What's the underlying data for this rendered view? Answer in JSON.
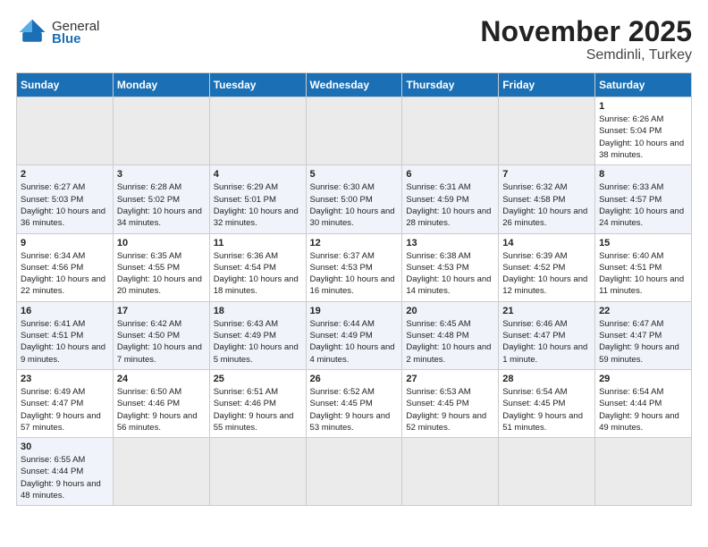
{
  "header": {
    "logo_general": "General",
    "logo_blue": "Blue",
    "title": "November 2025",
    "subtitle": "Semdinli, Turkey"
  },
  "days_of_week": [
    "Sunday",
    "Monday",
    "Tuesday",
    "Wednesday",
    "Thursday",
    "Friday",
    "Saturday"
  ],
  "weeks": [
    [
      {
        "day": "",
        "info": ""
      },
      {
        "day": "",
        "info": ""
      },
      {
        "day": "",
        "info": ""
      },
      {
        "day": "",
        "info": ""
      },
      {
        "day": "",
        "info": ""
      },
      {
        "day": "",
        "info": ""
      },
      {
        "day": "1",
        "info": "Sunrise: 6:26 AM\nSunset: 5:04 PM\nDaylight: 10 hours and 38 minutes."
      }
    ],
    [
      {
        "day": "2",
        "info": "Sunrise: 6:27 AM\nSunset: 5:03 PM\nDaylight: 10 hours and 36 minutes."
      },
      {
        "day": "3",
        "info": "Sunrise: 6:28 AM\nSunset: 5:02 PM\nDaylight: 10 hours and 34 minutes."
      },
      {
        "day": "4",
        "info": "Sunrise: 6:29 AM\nSunset: 5:01 PM\nDaylight: 10 hours and 32 minutes."
      },
      {
        "day": "5",
        "info": "Sunrise: 6:30 AM\nSunset: 5:00 PM\nDaylight: 10 hours and 30 minutes."
      },
      {
        "day": "6",
        "info": "Sunrise: 6:31 AM\nSunset: 4:59 PM\nDaylight: 10 hours and 28 minutes."
      },
      {
        "day": "7",
        "info": "Sunrise: 6:32 AM\nSunset: 4:58 PM\nDaylight: 10 hours and 26 minutes."
      },
      {
        "day": "8",
        "info": "Sunrise: 6:33 AM\nSunset: 4:57 PM\nDaylight: 10 hours and 24 minutes."
      }
    ],
    [
      {
        "day": "9",
        "info": "Sunrise: 6:34 AM\nSunset: 4:56 PM\nDaylight: 10 hours and 22 minutes."
      },
      {
        "day": "10",
        "info": "Sunrise: 6:35 AM\nSunset: 4:55 PM\nDaylight: 10 hours and 20 minutes."
      },
      {
        "day": "11",
        "info": "Sunrise: 6:36 AM\nSunset: 4:54 PM\nDaylight: 10 hours and 18 minutes."
      },
      {
        "day": "12",
        "info": "Sunrise: 6:37 AM\nSunset: 4:53 PM\nDaylight: 10 hours and 16 minutes."
      },
      {
        "day": "13",
        "info": "Sunrise: 6:38 AM\nSunset: 4:53 PM\nDaylight: 10 hours and 14 minutes."
      },
      {
        "day": "14",
        "info": "Sunrise: 6:39 AM\nSunset: 4:52 PM\nDaylight: 10 hours and 12 minutes."
      },
      {
        "day": "15",
        "info": "Sunrise: 6:40 AM\nSunset: 4:51 PM\nDaylight: 10 hours and 11 minutes."
      }
    ],
    [
      {
        "day": "16",
        "info": "Sunrise: 6:41 AM\nSunset: 4:51 PM\nDaylight: 10 hours and 9 minutes."
      },
      {
        "day": "17",
        "info": "Sunrise: 6:42 AM\nSunset: 4:50 PM\nDaylight: 10 hours and 7 minutes."
      },
      {
        "day": "18",
        "info": "Sunrise: 6:43 AM\nSunset: 4:49 PM\nDaylight: 10 hours and 5 minutes."
      },
      {
        "day": "19",
        "info": "Sunrise: 6:44 AM\nSunset: 4:49 PM\nDaylight: 10 hours and 4 minutes."
      },
      {
        "day": "20",
        "info": "Sunrise: 6:45 AM\nSunset: 4:48 PM\nDaylight: 10 hours and 2 minutes."
      },
      {
        "day": "21",
        "info": "Sunrise: 6:46 AM\nSunset: 4:47 PM\nDaylight: 10 hours and 1 minute."
      },
      {
        "day": "22",
        "info": "Sunrise: 6:47 AM\nSunset: 4:47 PM\nDaylight: 9 hours and 59 minutes."
      }
    ],
    [
      {
        "day": "23",
        "info": "Sunrise: 6:49 AM\nSunset: 4:47 PM\nDaylight: 9 hours and 57 minutes."
      },
      {
        "day": "24",
        "info": "Sunrise: 6:50 AM\nSunset: 4:46 PM\nDaylight: 9 hours and 56 minutes."
      },
      {
        "day": "25",
        "info": "Sunrise: 6:51 AM\nSunset: 4:46 PM\nDaylight: 9 hours and 55 minutes."
      },
      {
        "day": "26",
        "info": "Sunrise: 6:52 AM\nSunset: 4:45 PM\nDaylight: 9 hours and 53 minutes."
      },
      {
        "day": "27",
        "info": "Sunrise: 6:53 AM\nSunset: 4:45 PM\nDaylight: 9 hours and 52 minutes."
      },
      {
        "day": "28",
        "info": "Sunrise: 6:54 AM\nSunset: 4:45 PM\nDaylight: 9 hours and 51 minutes."
      },
      {
        "day": "29",
        "info": "Sunrise: 6:54 AM\nSunset: 4:44 PM\nDaylight: 9 hours and 49 minutes."
      }
    ],
    [
      {
        "day": "30",
        "info": "Sunrise: 6:55 AM\nSunset: 4:44 PM\nDaylight: 9 hours and 48 minutes."
      },
      {
        "day": "",
        "info": ""
      },
      {
        "day": "",
        "info": ""
      },
      {
        "day": "",
        "info": ""
      },
      {
        "day": "",
        "info": ""
      },
      {
        "day": "",
        "info": ""
      },
      {
        "day": "",
        "info": ""
      }
    ]
  ]
}
